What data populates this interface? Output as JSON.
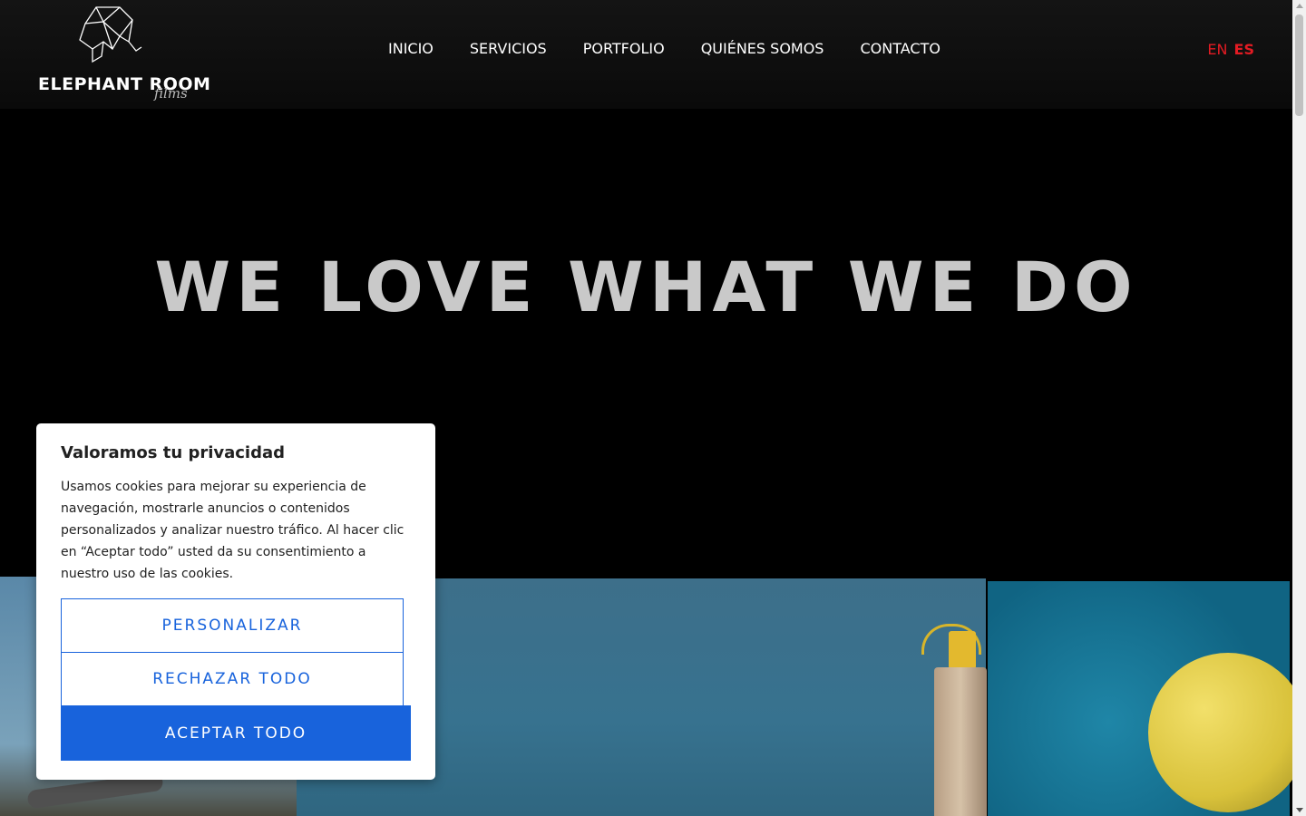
{
  "brand": {
    "name": "ELEPHANT ROOM",
    "sub": "films"
  },
  "nav": {
    "items": [
      {
        "label": "INICIO"
      },
      {
        "label": "SERVICIOS"
      },
      {
        "label": "PORTFOLIO"
      },
      {
        "label": "QUIÉNES SOMOS"
      },
      {
        "label": "CONTACTO"
      }
    ]
  },
  "lang": {
    "en": "EN",
    "es": "ES",
    "active": "ES",
    "color": "#e31b23"
  },
  "hero": {
    "title": "WE LOVE WHAT WE DO"
  },
  "cookie": {
    "title": "Valoramos tu privacidad",
    "body": "Usamos cookies para mejorar su experiencia de navegación, mostrarle anuncios o contenidos personalizados y analizar nuestro tráfico. Al hacer clic en “Aceptar todo” usted da su consentimiento a nuestro uso de las cookies.",
    "customize": "PERSONALIZAR",
    "reject": "RECHAZAR TODO",
    "accept": "ACEPTAR TODO",
    "accent": "#1863dc"
  }
}
